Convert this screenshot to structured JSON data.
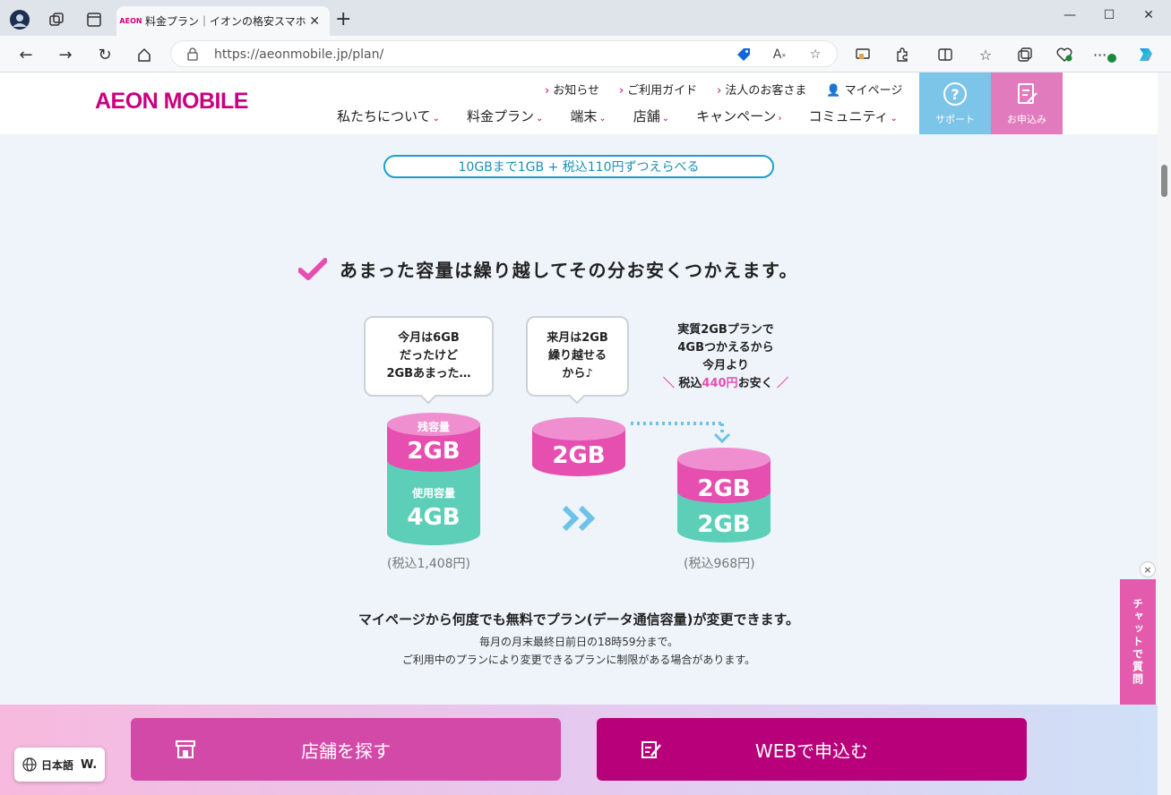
{
  "browser": {
    "tab_title": "料金プラン｜イオンの格安スマホ・格安",
    "tab_favicon": "AEON",
    "url": "https://aeonmobile.jp/plan/"
  },
  "header": {
    "logo": "AEON MOBILE",
    "top_links": [
      "お知らせ",
      "ご利用ガイド",
      "法人のお客さま",
      "マイページ"
    ],
    "nav": [
      "私たちについて",
      "料金プラン",
      "端末",
      "店舗",
      "キャンペーン",
      "コミュニティ"
    ],
    "support_label": "サポート",
    "apply_label": "お申込み",
    "support_color": "#7cc4e8",
    "apply_color": "#e27bbd"
  },
  "content": {
    "pill_text": "10GBまで1GB + 税込110円ずつえらべる",
    "headline": "あまった容量は繰り越してその分お安くつかえます。",
    "bubble1": [
      "今月は6GB",
      "だったけど",
      "2GBあまった…"
    ],
    "bubble2": [
      "来月は2GB",
      "繰り越せる",
      "から♪"
    ],
    "callout_line1": "実質2GBプランで",
    "callout_line2": "4GBつかえるから",
    "callout_line3": "今月より",
    "callout_pre": "税込",
    "callout_amount": "440円",
    "callout_post": "お安く",
    "cyl1_top_label": "残容量",
    "cyl1_top_value": "2GB",
    "cyl1_bottom_label": "使用容量",
    "cyl1_bottom_value": "4GB",
    "cyl2_value": "2GB",
    "cyl3_top_value": "2GB",
    "cyl3_bottom_value": "2GB",
    "price1": "(税込1,408円)",
    "price2": "(税込968円)",
    "note_main": "マイページから何度でも無料でプラン(データ通信容量)が変更できます。",
    "note_sub1": "毎月の月末最終日前日の18時59分まで。",
    "note_sub2": "ご利用中のプランにより変更できるプランに制限がある場合があります。",
    "pink": "#e64fb0",
    "teal": "#5dcfb9"
  },
  "footer": {
    "store_button": "店舗を探す",
    "web_button": "WEBで申込む",
    "language": "日本語",
    "language_brand": "W.",
    "chat": "チャットで質問",
    "chat_close": "×"
  }
}
